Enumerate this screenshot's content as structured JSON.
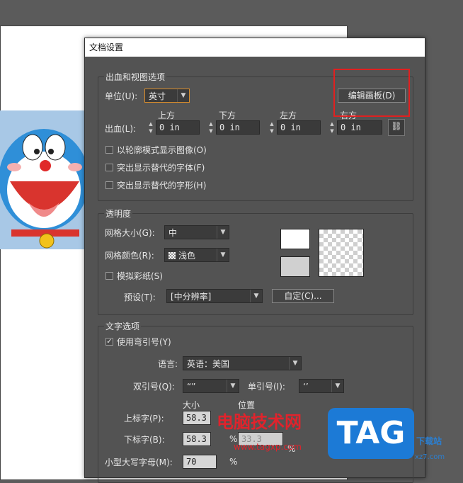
{
  "dialog": {
    "title": "文档设置"
  },
  "bleed_view": {
    "legend": "出血和视图选项",
    "units_label": "单位(U):",
    "units_value": "英寸",
    "edit_artboard_button": "编辑画板(D)",
    "bleed_label": "出血(L):",
    "bleed": [
      {
        "label": "上方",
        "value": "0 in"
      },
      {
        "label": "下方",
        "value": "0 in"
      },
      {
        "label": "左方",
        "value": "0 in"
      },
      {
        "label": "右方",
        "value": "0 in"
      }
    ],
    "checkboxes": [
      {
        "label": "以轮廓模式显示图像(O)",
        "checked": false
      },
      {
        "label": "突出显示替代的字体(F)",
        "checked": false
      },
      {
        "label": "突出显示替代的字形(H)",
        "checked": false
      }
    ]
  },
  "transparency": {
    "legend": "透明度",
    "grid_size_label": "网格大小(G):",
    "grid_size_value": "中",
    "grid_color_label": "网格颜色(R):",
    "grid_color_value": "浅色",
    "simulate_paper_label": "模拟彩纸(S)",
    "simulate_paper_checked": false,
    "preset_label": "预设(T):",
    "preset_value": "[中分辨率]",
    "custom_button": "自定(C)..."
  },
  "type_options": {
    "legend": "文字选项",
    "use_quotes_label": "使用弯引号(Y)",
    "use_quotes_checked": true,
    "language_label": "语言:",
    "language_value": "英语：美国",
    "double_quotes_label": "双引号(Q):",
    "double_quotes_value": "“”",
    "single_quotes_label": "单引号(I):",
    "single_quotes_value": "‘’",
    "size_header": "大小",
    "position_header": "位置",
    "superscript_label": "上标字(P):",
    "superscript_size": "58.3",
    "subscript_label": "下标字(B):",
    "subscript_size": "58.3",
    "subscript_position": "33.3",
    "smallcaps_label": "小型大写字母(M):",
    "smallcaps_size": "70",
    "percent": "%"
  },
  "watermark": {
    "text": "电脑技术网",
    "url": "www.tagxp.com",
    "logo": "TAG",
    "side_text": "下载站",
    "side_url": "xz7.com"
  },
  "colors": {
    "highlight_box": "#e02020",
    "dialog_bg": "#535353",
    "accent_focus": "#d98c2b"
  }
}
